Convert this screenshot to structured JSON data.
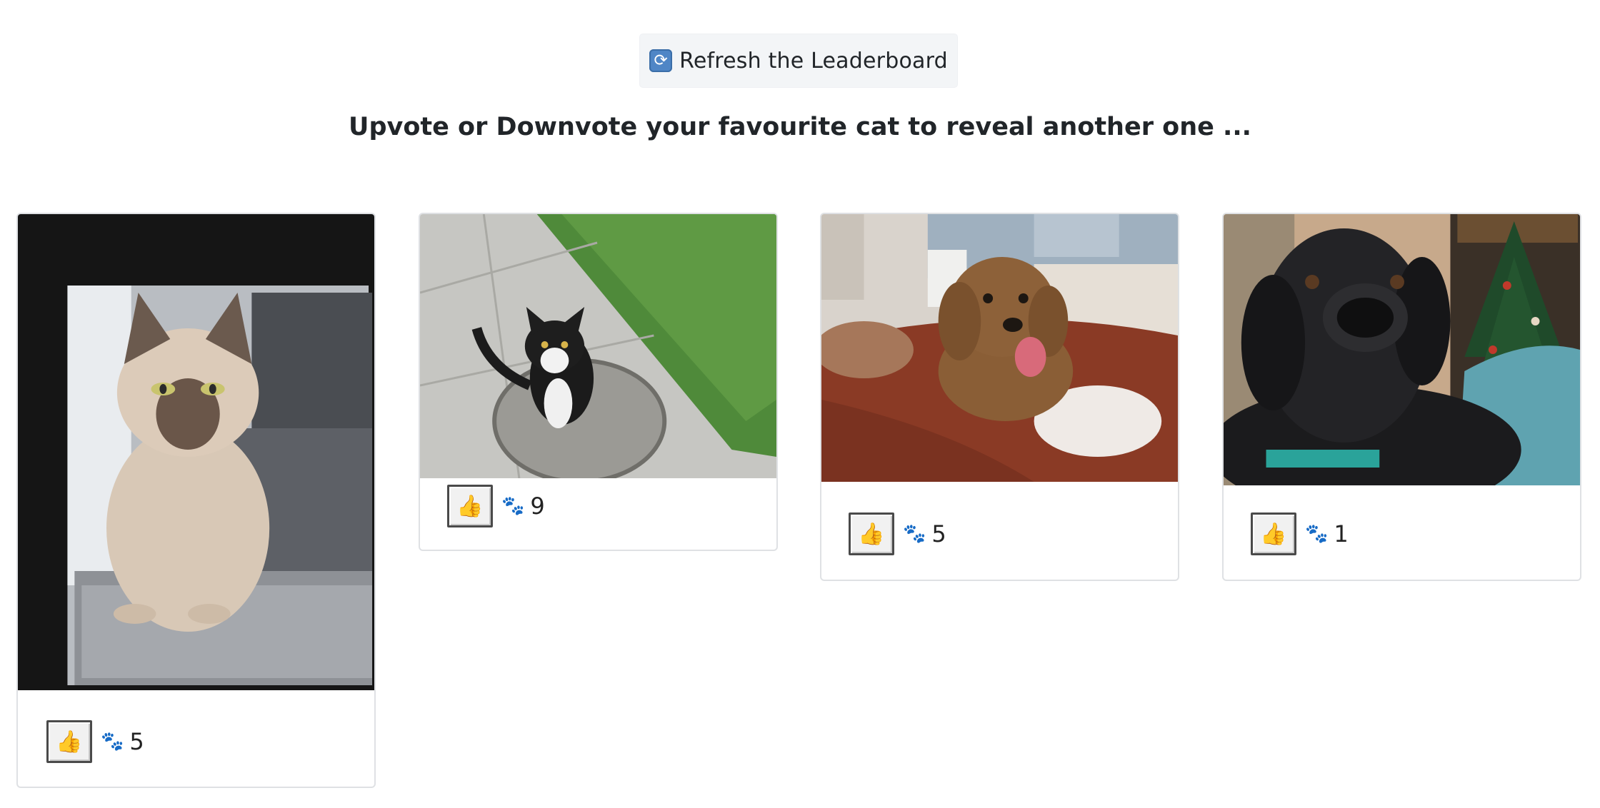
{
  "header": {
    "refresh_button": {
      "icon": "refresh-icon",
      "icon_glyph": "⟳",
      "label": "Refresh the Leaderboard"
    },
    "instruction": "Upvote or Downvote your favourite cat to reveal another one ..."
  },
  "cards": [
    {
      "subject": "grumpy-siamese-cat-photo",
      "vote_icon": "thumbs-up-icon",
      "vote_glyph": "👍",
      "paw_icon": "paw-icon",
      "paw_glyph": "🐾",
      "votes": "5"
    },
    {
      "subject": "tuxedo-cat-photo",
      "vote_icon": "thumbs-up-icon",
      "vote_glyph": "👍",
      "paw_icon": "paw-icon",
      "paw_glyph": "🐾",
      "votes": "9"
    },
    {
      "subject": "brown-puppy-photo",
      "vote_icon": "thumbs-up-icon",
      "vote_glyph": "👍",
      "paw_icon": "paw-icon",
      "paw_glyph": "🐾",
      "votes": "5"
    },
    {
      "subject": "black-labrador-photo",
      "vote_icon": "thumbs-up-icon",
      "vote_glyph": "👍",
      "paw_icon": "paw-icon",
      "paw_glyph": "🐾",
      "votes": "1"
    }
  ],
  "colors": {
    "refresh_bg": "#f3f5f7",
    "card_border": "#dfe1e4",
    "text": "#212529"
  }
}
